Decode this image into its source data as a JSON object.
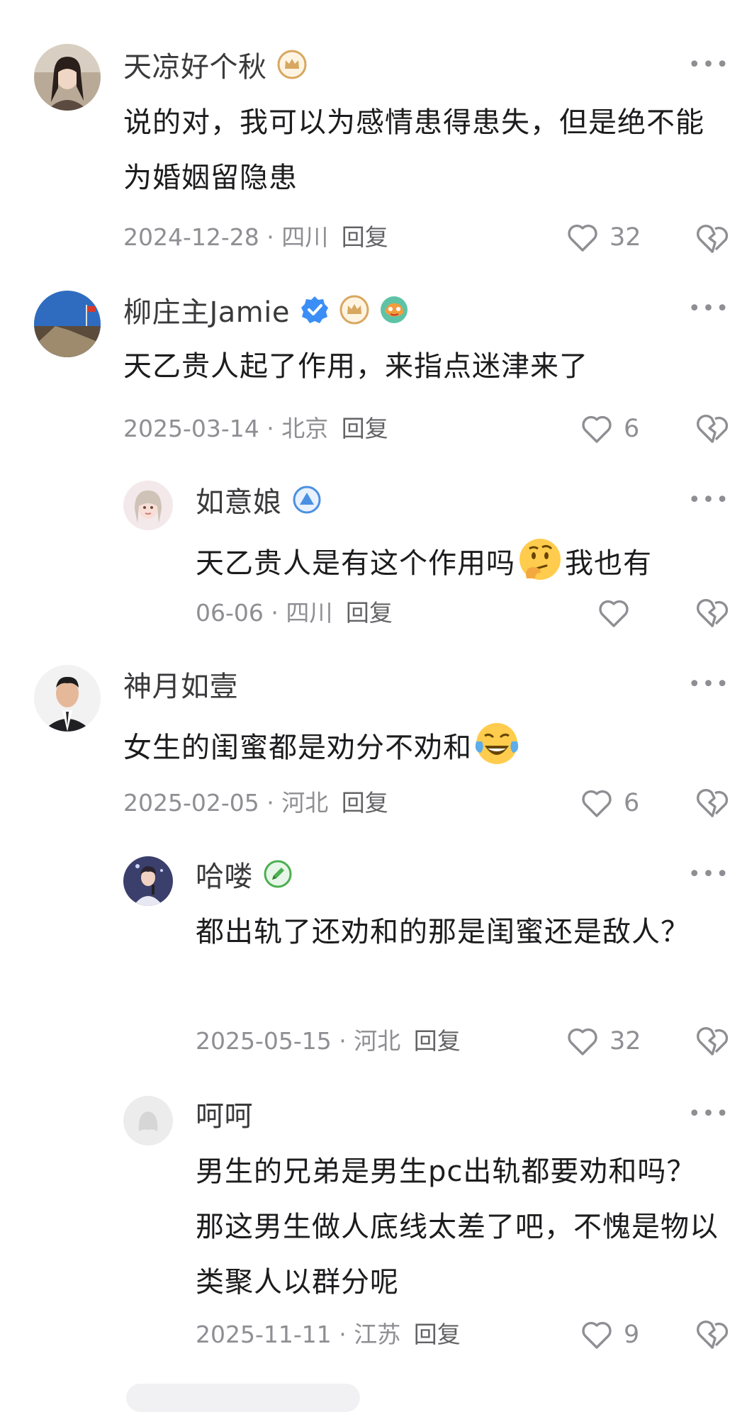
{
  "comments": [
    {
      "username": "天凉好个秋",
      "badges": [
        "crown-badge"
      ],
      "content": "说的对，我可以为感情患得患失，但是绝不能为婚姻留隐患",
      "date": "2024-12-28",
      "location": "四川",
      "reply_label": "回复",
      "likes": "32"
    },
    {
      "username": "柳庄主Jamie",
      "badges": [
        "verified-badge",
        "crown-badge",
        "creator-badge"
      ],
      "content": "天乙贵人起了作用，来指点迷津来了",
      "date": "2025-03-14",
      "location": "北京",
      "reply_label": "回复",
      "likes": "6"
    },
    {
      "username": "如意娘",
      "badges": [
        "level-up-badge"
      ],
      "content_before_emoji": "天乙贵人是有这个作用吗",
      "emoji": "thinking-face-emoji",
      "content_after_emoji": "我也有",
      "date": "06-06",
      "location": "四川",
      "reply_label": "回复",
      "likes": ""
    },
    {
      "username": "神月如壹",
      "badges": [],
      "content_before_emoji": "女生的闺蜜都是劝分不劝和",
      "emoji": "laughing-crying-face-emoji",
      "date": "2025-02-05",
      "location": "河北",
      "reply_label": "回复",
      "likes": "6"
    },
    {
      "username": "哈喽",
      "badges": [
        "pencil-badge"
      ],
      "content": "都出轨了还劝和的那是闺蜜还是敌人？",
      "date": "2025-05-15",
      "location": "河北",
      "reply_label": "回复",
      "likes": "32"
    },
    {
      "username": "呵呵",
      "badges": [],
      "content": "男生的兄弟是男生pc出轨都要劝和吗？那这男生做人底线太差了吧，不愧是物以类聚人以群分呢",
      "date": "2025-11-11",
      "location": "江苏",
      "reply_label": "回复",
      "likes": "9"
    }
  ],
  "more_label": "•••",
  "separator": "·",
  "colors": {
    "crown_badge": "#d8a760",
    "verified_badge": "#3a8ef6",
    "level_badge": "#4a90e2",
    "pencil_badge": "#4caf50",
    "icon_gray": "#8e8e93"
  }
}
